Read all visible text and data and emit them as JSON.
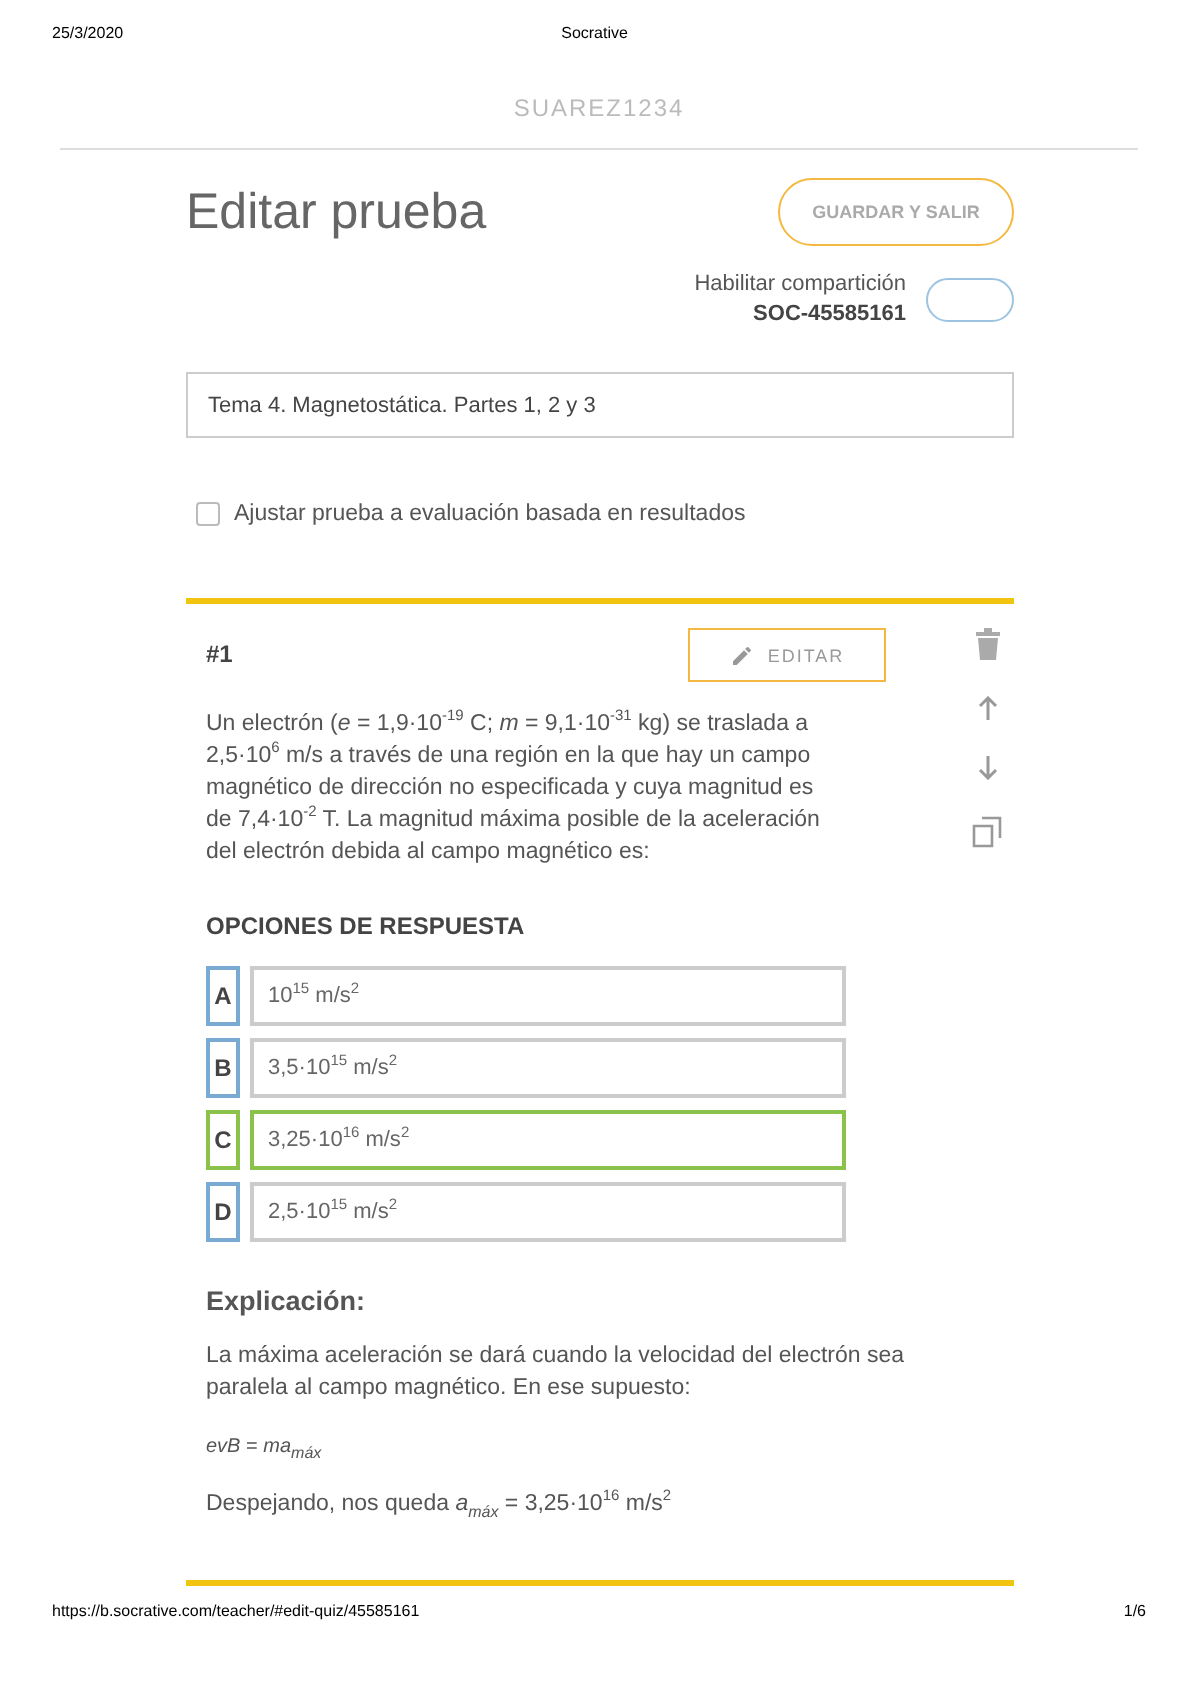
{
  "print_header": {
    "date": "25/3/2020",
    "title": "Socrative"
  },
  "room": "SUAREZ1234",
  "page_title": "Editar prueba",
  "save_button": "GUARDAR Y SALIR",
  "sharing": {
    "label": "Habilitar compartición",
    "code": "SOC-45585161",
    "on": false
  },
  "quiz_name": "Tema 4. Magnetostática. Partes 1, 2 y 3",
  "adjust_option": {
    "label": "Ajustar prueba a evaluación basada en resultados",
    "checked": false
  },
  "question": {
    "number": "#1",
    "edit_button": "EDITAR",
    "text": "Un electrón (*e* = 1,9·10$^{-19}$ C; *m* = 9,1·10$^{-31}$ kg) se traslada a 2,5·10$^{6}$ m/s a través de una región en la que hay un campo magnético de dirección no especificada y cuya magnitud es de 7,4·10$^{-2}$ T. La magnitud máxima posible de la aceleración del electrón debida al campo magnético es:",
    "options_heading": "OPCIONES DE RESPUESTA",
    "options": [
      {
        "letter": "A",
        "text": "10$^{15}$ m/s$^{2}$",
        "correct": false
      },
      {
        "letter": "B",
        "text": "3,5·10$^{15}$ m/s$^{2}$",
        "correct": false
      },
      {
        "letter": "C",
        "text": "3,25·10$^{16}$ m/s$^{2}$",
        "correct": true
      },
      {
        "letter": "D",
        "text": "2,5·10$^{15}$ m/s$^{2}$",
        "correct": false
      }
    ],
    "explanation_heading": "Explicación:",
    "explanation": [
      {
        "kind": "text",
        "text": "La máxima aceleración se dará cuando la velocidad del electrón sea paralela al campo magnético. En ese supuesto:"
      },
      {
        "kind": "formula",
        "text": "*evB* = *ma*$_{máx}$"
      },
      {
        "kind": "text",
        "text": "Despejando, nos queda *a*$_{máx}$ = 3,25·10$^{16}$ m/s$^{2}$"
      }
    ]
  },
  "print_footer": {
    "url": "https://b.socrative.com/teacher/#edit-quiz/45585161",
    "page": "1/6"
  }
}
